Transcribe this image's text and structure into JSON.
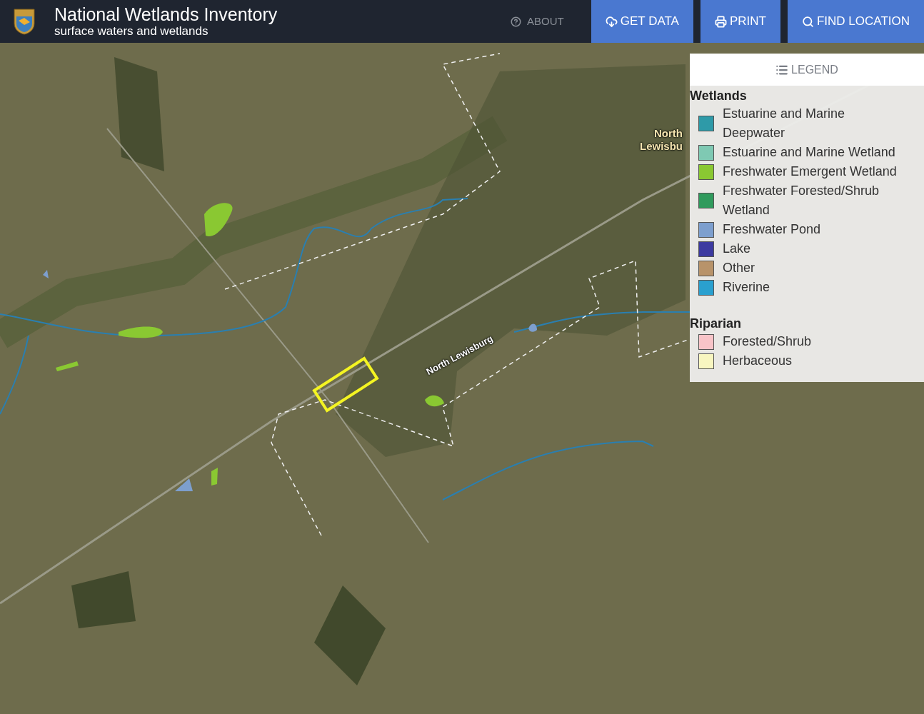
{
  "header": {
    "title": "National Wetlands Inventory",
    "subtitle": "surface waters and wetlands"
  },
  "nav": [
    {
      "label": "ABOUT",
      "kind": "link"
    },
    {
      "label": "GET DATA",
      "kind": "button"
    },
    {
      "label": "PRINT",
      "kind": "button"
    },
    {
      "label": "FIND LOCATION",
      "kind": "button"
    }
  ],
  "map": {
    "labels": [
      {
        "text": "North\nLewisbu",
        "kind": "town"
      },
      {
        "text": "North Lewisburg",
        "kind": "road"
      }
    ]
  },
  "legend": {
    "title": "LEGEND",
    "sections": [
      {
        "heading": "Wetlands",
        "items": [
          {
            "label": "Estuarine and Marine Deepwater",
            "color": "#2e9aa8"
          },
          {
            "label": "Estuarine and Marine Wetland",
            "color": "#7fc9b3"
          },
          {
            "label": "Freshwater Emergent Wetland",
            "color": "#8ac832"
          },
          {
            "label": "Freshwater Forested/Shrub Wetland",
            "color": "#2f9a5c"
          },
          {
            "label": "Freshwater Pond",
            "color": "#7d9fce"
          },
          {
            "label": "Lake",
            "color": "#3d3aa0"
          },
          {
            "label": "Other",
            "color": "#b8936a"
          },
          {
            "label": "Riverine",
            "color": "#2aa0cf"
          }
        ]
      },
      {
        "heading": "Riparian",
        "items": [
          {
            "label": "Forested/Shrub",
            "color": "#f8c4c8"
          },
          {
            "label": "Herbaceous",
            "color": "#f8f6c0"
          }
        ]
      }
    ]
  }
}
